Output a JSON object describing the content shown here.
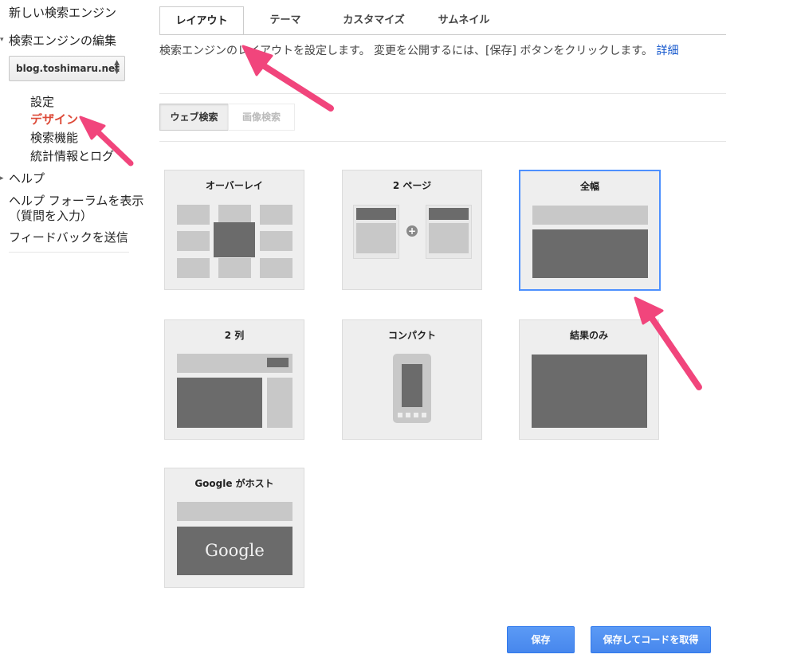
{
  "sidebar": {
    "new_engine": "新しい検索エンジン",
    "edit_engine": "検索エンジンの編集",
    "site": "blog.toshimaru.net",
    "sub_items": [
      "設定",
      "デザイン",
      "検索機能",
      "統計情報とログ"
    ],
    "help": "ヘルプ",
    "forum_line1": "ヘルプ フォーラムを表示",
    "forum_line2": "（質問を入力）",
    "feedback": "フィードバックを送信"
  },
  "tabs": [
    "レイアウト",
    "テーマ",
    "カスタマイズ",
    "サムネイル"
  ],
  "description": "検索エンジンのレイアウトを設定します。 変更を公開するには、[保存] ボタンをクリックします。",
  "details_link": "詳細",
  "search_type": {
    "web": "ウェブ検索",
    "image": "画像検索"
  },
  "layouts": {
    "overlay": "オーバーレイ",
    "two_page": "2 ページ",
    "full_width": "全幅",
    "two_column": "2 列",
    "compact": "コンパクト",
    "results_only": "結果のみ",
    "google_hosted": "Google がホスト",
    "google_logo_text": "Google"
  },
  "selected_layout": "全幅",
  "buttons": {
    "save": "保存",
    "save_get_code": "保存してコードを取得"
  },
  "annotation_color": "#f1457c"
}
